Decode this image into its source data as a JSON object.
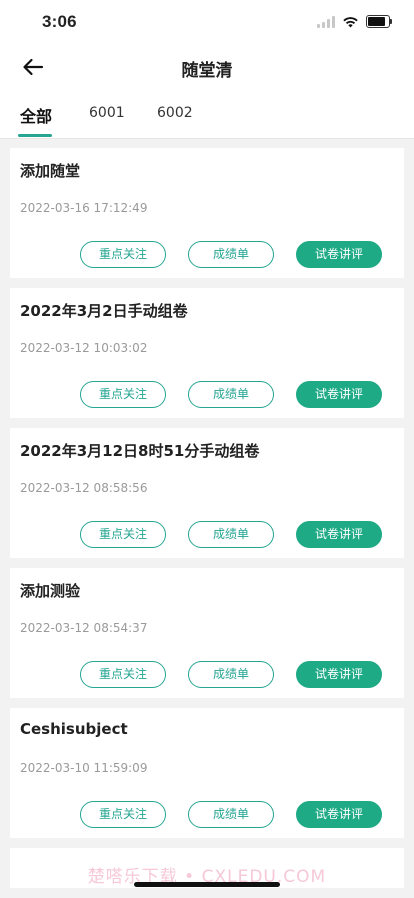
{
  "status": {
    "time": "3:06"
  },
  "nav": {
    "title": "随堂清",
    "back_icon": "arrow-left-icon"
  },
  "tabs": [
    {
      "label": "全部",
      "active": true
    },
    {
      "label": "6001",
      "active": false
    },
    {
      "label": "6002",
      "active": false
    }
  ],
  "buttons": {
    "focus": "重点关注",
    "grades": "成绩单",
    "review": "试卷讲评"
  },
  "cards": [
    {
      "title": "添加随堂",
      "date": "2022-03-16 17:12:49"
    },
    {
      "title": "2022年3月2日手动组卷",
      "date": "2022-03-12 10:03:02"
    },
    {
      "title": "2022年3月12日8时51分手动组卷",
      "date": "2022-03-12 08:58:56"
    },
    {
      "title": "添加测验",
      "date": "2022-03-12 08:54:37"
    },
    {
      "title": "Ceshisubject",
      "date": "2022-03-10 11:59:09"
    }
  ],
  "watermark": "楚嗒乐下载 • CXLEDU.COM",
  "colors": {
    "accent": "#25a592",
    "accent_solid": "#1faa86",
    "background": "#f2f2f2"
  }
}
